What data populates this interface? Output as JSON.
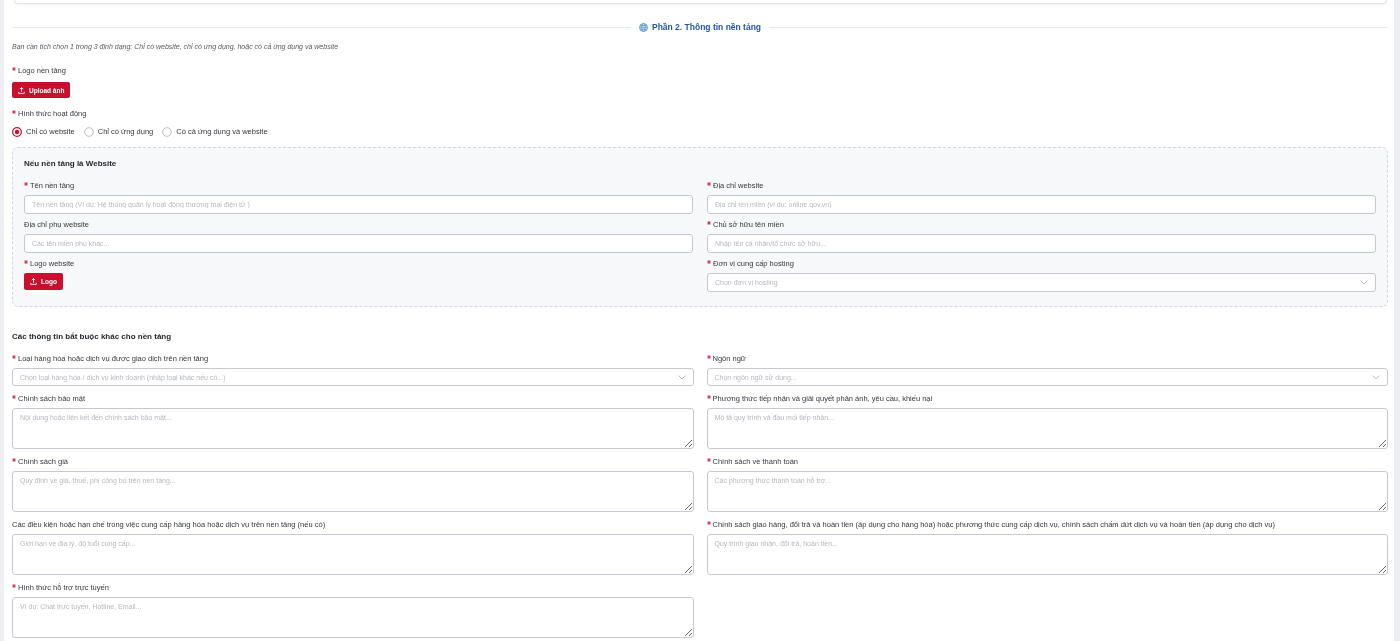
{
  "section": {
    "title": "Phần 2. Thông tin nền tảng",
    "note": "Bạn cần tích chọn 1 trong 3 định dạng: Chỉ có website, chỉ có ứng dụng, hoặc có cả ứng dụng và website"
  },
  "platform_logo": {
    "label": "Logo nền tảng",
    "required": true,
    "button": "Upload ảnh"
  },
  "operation_mode": {
    "label": "Hình thức hoạt động",
    "required": true,
    "options": [
      {
        "label": "Chỉ có website",
        "selected": true
      },
      {
        "label": "Chỉ có ứng dụng",
        "selected": false
      },
      {
        "label": "Có cả ứng dụng và website",
        "selected": false
      }
    ]
  },
  "website_panel": {
    "title": "Nếu nền tảng là Website",
    "fields": [
      {
        "kind": "input",
        "label": "Tên nền tảng",
        "required": true,
        "placeholder": "Tên nền tảng (Ví dụ: Hệ thống quản lý hoạt động thương mại điện tử )"
      },
      {
        "kind": "input",
        "label": "Địa chỉ website",
        "required": true,
        "placeholder": "Địa chỉ tên miền (ví dụ: online.gov.vn)"
      },
      {
        "kind": "input",
        "label": "Địa chỉ phụ website",
        "required": false,
        "placeholder": "Các tên miền phụ khác..."
      },
      {
        "kind": "input",
        "label": "Chủ sở hữu tên miền",
        "required": true,
        "placeholder": "Nhập tên cá nhân/tổ chức sở hữu..."
      },
      {
        "kind": "upload",
        "label": "Logo website",
        "required": true,
        "button": "Logo"
      },
      {
        "kind": "select",
        "label": "Đơn vị cung cấp hosting",
        "required": true,
        "placeholder": "Chọn đơn vị hosting"
      }
    ]
  },
  "other_info": {
    "title": "Các thông tin bắt buộc khác cho nền tảng",
    "fields": [
      {
        "kind": "select",
        "label": "Loại hàng hóa hoặc dịch vụ được giao dịch trên nền tảng",
        "required": true,
        "placeholder": "Chọn loại hàng hóa / dịch vụ kinh doanh (nhập loại khác nếu có...)"
      },
      {
        "kind": "select",
        "label": "Ngôn ngữ",
        "required": true,
        "placeholder": "Chọn ngôn ngữ sử dụng..."
      },
      {
        "kind": "textarea",
        "label": "Chính sách bảo mật",
        "required": true,
        "placeholder": "Nội dung hoặc liên kết đến chính sách bảo mật..."
      },
      {
        "kind": "textarea",
        "label": "Phương thức tiếp nhận và giải quyết phản ánh, yêu cầu, khiếu nại",
        "required": true,
        "placeholder": "Mô tả quy trình và đầu mối tiếp nhận..."
      },
      {
        "kind": "textarea",
        "label": "Chính sách giá",
        "required": true,
        "placeholder": "Quy định về giá, thuế, phí công bố trên nền tảng..."
      },
      {
        "kind": "textarea",
        "label": "Chính sách về thanh toán",
        "required": true,
        "placeholder": "Các phương thức thanh toán hỗ trợ..."
      },
      {
        "kind": "textarea",
        "label": "Các điều kiện hoặc hạn chế trong việc cung cấp hàng hóa hoặc dịch vụ trên nền tảng (nếu có)",
        "required": false,
        "placeholder": "Giới hạn về địa lý, độ tuổi cung cấp..."
      },
      {
        "kind": "textarea",
        "label": "Chính sách giao hàng, đổi trả và hoàn tiền (áp dụng cho hàng hóa) hoặc phương thức cung cấp dịch vụ, chính sách chấm dứt dịch vụ và hoàn tiền (áp dụng cho dịch vụ)",
        "required": true,
        "placeholder": "Quy trình giao nhận, đổi trả, hoàn tiền..."
      },
      {
        "kind": "textarea",
        "label": "Hình thức hỗ trợ trực tuyến",
        "required": true,
        "placeholder": "Ví dụ: Chat trực tuyến, Hotline, Email..."
      }
    ]
  }
}
